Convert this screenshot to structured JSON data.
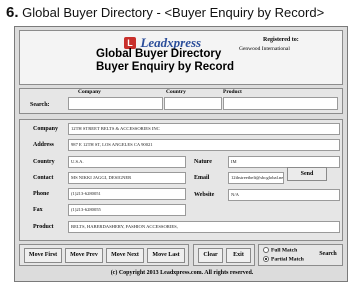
{
  "caption": {
    "number": "6.",
    "text": "Global Buyer Directory - <Buyer Enquiry by Record>"
  },
  "header": {
    "logo_mark": "L",
    "logo_text": "Leadxpress",
    "title_line1": "Global Buyer Directory",
    "title_line2": "Buyer Enquiry by Record",
    "registered_label": "Registered to:",
    "registered_value": "Genwood International"
  },
  "search": {
    "label": "Search:",
    "columns": [
      "Company",
      "Country",
      "Product"
    ],
    "values": [
      "",
      "",
      ""
    ]
  },
  "record": {
    "company_label": "Company",
    "company": "12TH STREET BELTS & ACCESSORIES INC",
    "address_label": "Address",
    "address": "987 E 12TH ST, LOS ANGELES CA 90021",
    "country_label": "Country",
    "country": "U.S.A.",
    "nature_label": "Nature",
    "nature": "IM",
    "contact_label": "Contact",
    "contact": "MS NIKKI JAGGI, DESIGNER",
    "email_label": "Email",
    "email": "12thstreetbelt@sbcglobal.net",
    "send_label": "Send",
    "phone_label": "Phone",
    "phone": "(1)213-6280051",
    "website_label": "Website",
    "website": "N/A",
    "fax_label": "Fax",
    "fax": "(1)213-6280055",
    "product_label": "Product",
    "product": "BELTS, HABERDASHERY, FASHION ACCESSORIES,"
  },
  "nav": {
    "first": "Move First",
    "prev": "Move Prev",
    "next": "Move Next",
    "last": "Move Last"
  },
  "actions": {
    "clear": "Clear",
    "exit": "Exit"
  },
  "match": {
    "full": "Full Match",
    "partial": "Partial Match",
    "search": "Search",
    "selected": "partial"
  },
  "footer": {
    "copyright": "(c) Copyright 2013 Leadxpress.com.  All rights reserved."
  }
}
